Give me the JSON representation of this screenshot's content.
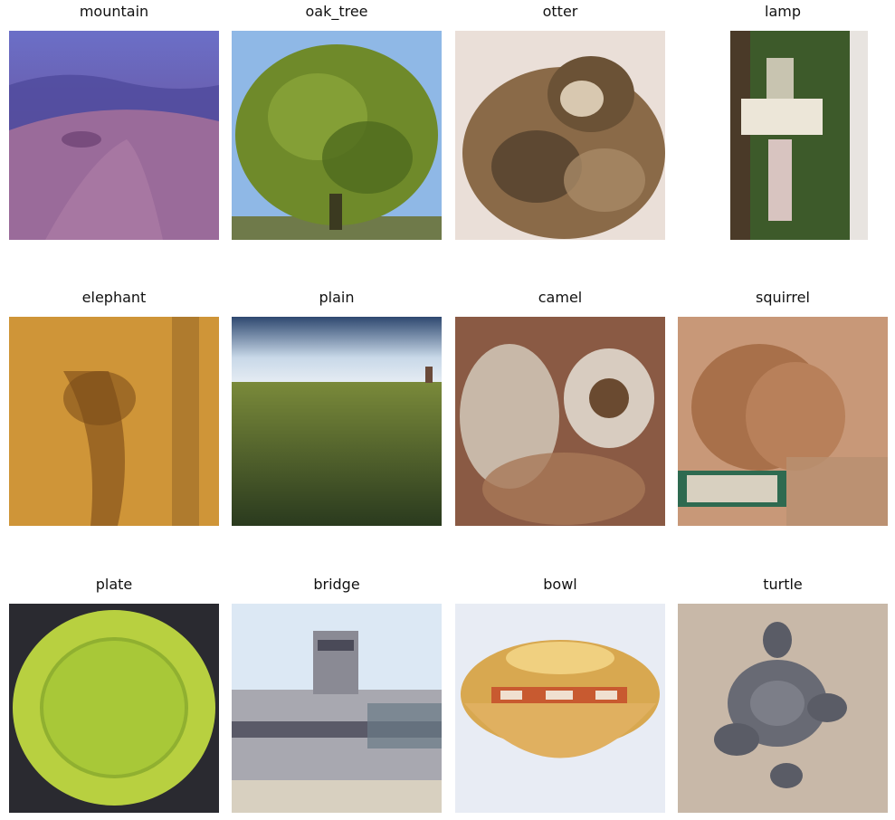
{
  "figure": {
    "tiles": [
      {
        "label": "mountain",
        "icon": "mountain-photo"
      },
      {
        "label": "oak_tree",
        "icon": "oak-tree-photo"
      },
      {
        "label": "otter",
        "icon": "otter-photo"
      },
      {
        "label": "lamp",
        "icon": "lamp-photo"
      },
      {
        "label": "elephant",
        "icon": "elephant-photo"
      },
      {
        "label": "plain",
        "icon": "plain-photo"
      },
      {
        "label": "camel",
        "icon": "camel-photo"
      },
      {
        "label": "squirrel",
        "icon": "squirrel-photo"
      },
      {
        "label": "plate",
        "icon": "plate-photo"
      },
      {
        "label": "bridge",
        "icon": "bridge-photo"
      },
      {
        "label": "bowl",
        "icon": "bowl-photo"
      },
      {
        "label": "turtle",
        "icon": "turtle-photo"
      }
    ]
  }
}
